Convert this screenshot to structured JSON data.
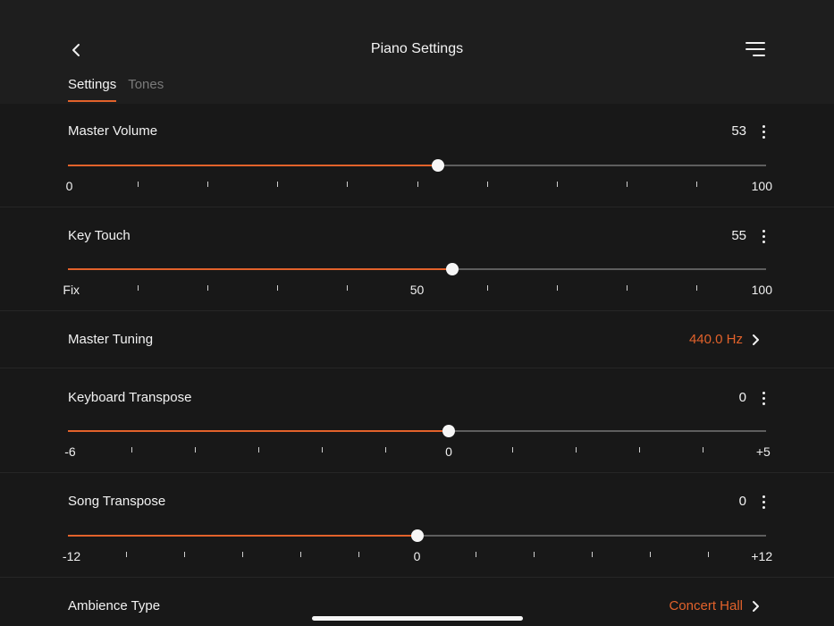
{
  "colors": {
    "accent": "#e2622b",
    "background": "#181818",
    "header": "#1e1e1e"
  },
  "header": {
    "title": "Piano Settings",
    "back_icon": "chevron-left-icon",
    "menu_icon": "menu-icon"
  },
  "tabs": [
    {
      "label": "Settings",
      "active": true
    },
    {
      "label": "Tones",
      "active": false
    }
  ],
  "settings": {
    "master_volume": {
      "label": "Master Volume",
      "value": "53",
      "slider": {
        "min": 0,
        "max": 100,
        "current": 53
      },
      "scale_labels": [
        {
          "text": "0",
          "at": 0
        },
        {
          "text": "100",
          "at": 100
        }
      ],
      "ticks": 11
    },
    "key_touch": {
      "label": "Key Touch",
      "value": "55",
      "slider": {
        "min": 0,
        "max": 100,
        "current": 55
      },
      "scale_labels": [
        {
          "text": "Fix",
          "at": 0
        },
        {
          "text": "50",
          "at": 50
        },
        {
          "text": "100",
          "at": 100
        }
      ],
      "ticks": 11
    },
    "master_tuning": {
      "label": "Master Tuning",
      "value": "440.0 Hz"
    },
    "keyboard_transpose": {
      "label": "Keyboard Transpose",
      "value": "0",
      "slider": {
        "min": -6,
        "max": 5,
        "current": 0
      },
      "scale_labels": [
        {
          "text": "-6",
          "at": -6
        },
        {
          "text": "0",
          "at": 0
        },
        {
          "text": "+5",
          "at": 5
        }
      ],
      "ticks": 12
    },
    "song_transpose": {
      "label": "Song Transpose",
      "value": "0",
      "slider": {
        "min": -12,
        "max": 12,
        "current": 0
      },
      "scale_labels": [
        {
          "text": "-12",
          "at": -12
        },
        {
          "text": "0",
          "at": 0
        },
        {
          "text": "+12",
          "at": 12
        }
      ],
      "ticks": 13
    },
    "ambience_type": {
      "label": "Ambience Type",
      "value": "Concert Hall"
    }
  }
}
